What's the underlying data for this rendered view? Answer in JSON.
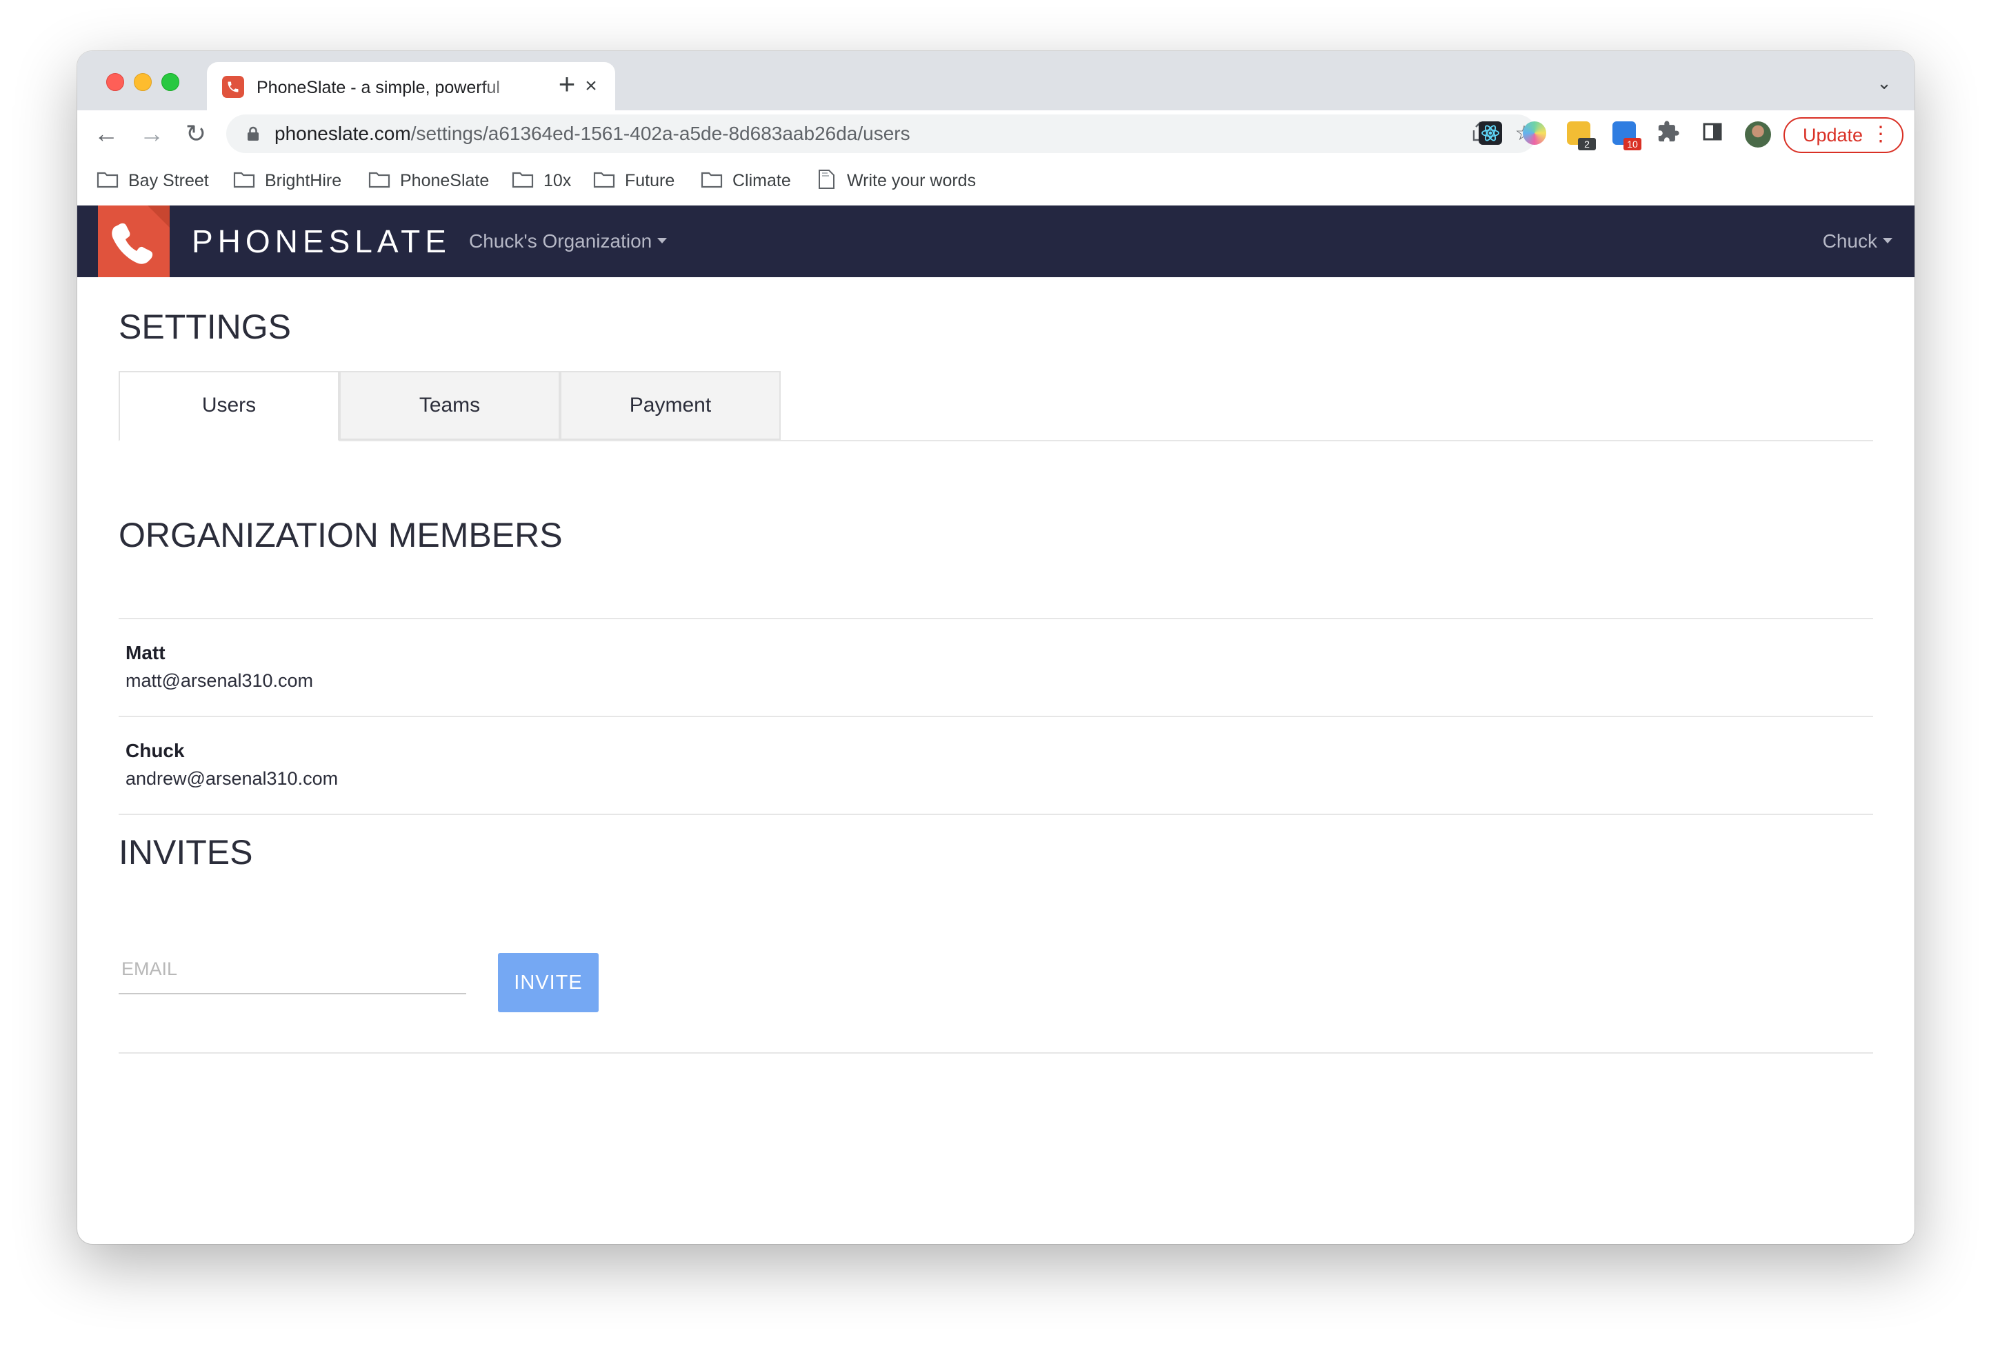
{
  "browser": {
    "tab_title": "PhoneSlate - a simple, powerful",
    "url_host": "phoneslate.com",
    "url_path": "/settings/a61364ed-1561-402a-a5de-8d683aab26da/users",
    "update_label": "Update",
    "extensions": [
      {
        "icon": "react-devtools-icon",
        "badge": ""
      },
      {
        "icon": "colorzilla-icon",
        "badge": ""
      },
      {
        "icon": "sticky-notes-extension-icon",
        "badge": "2"
      },
      {
        "icon": "task-extension-icon",
        "badge": "10"
      }
    ],
    "bookmarks": [
      "Bay Street",
      "BrightHire",
      "PhoneSlate",
      "10x",
      "Future",
      "Climate",
      "Write your words"
    ]
  },
  "app": {
    "brand": "PHONESLATE",
    "organization": "Chuck's Organization",
    "user": "Chuck",
    "brand_color": "#e0533d",
    "nav_color": "#242741"
  },
  "settings": {
    "title": "SETTINGS",
    "tabs": [
      "Users",
      "Teams",
      "Payment"
    ],
    "active_tab": "Users"
  },
  "members": {
    "title": "ORGANIZATION MEMBERS",
    "list": [
      {
        "name": "Matt",
        "email": "matt@arsenal310.com"
      },
      {
        "name": "Chuck",
        "email": "andrew@arsenal310.com"
      }
    ]
  },
  "invites": {
    "title": "INVITES",
    "email_placeholder": "EMAIL",
    "invite_label": "INVITE",
    "button_color": "#75a8f3"
  }
}
